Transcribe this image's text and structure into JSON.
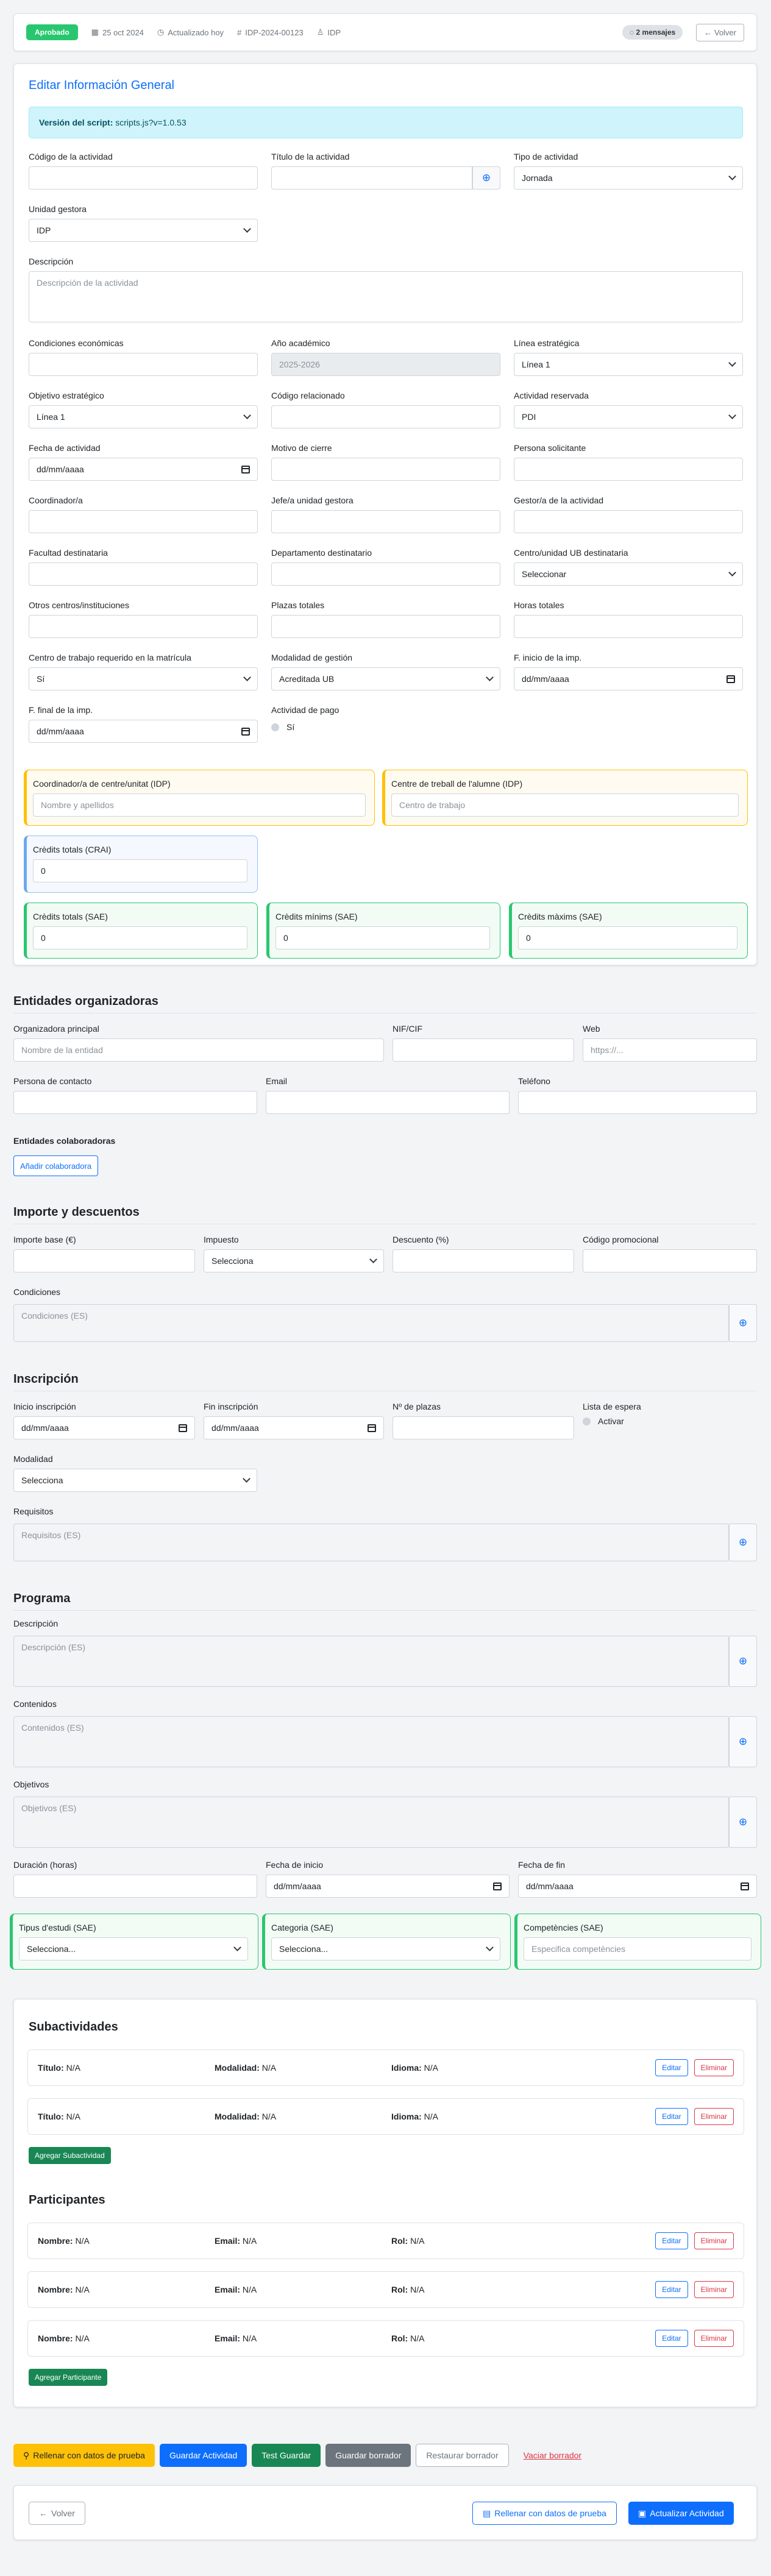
{
  "header": {
    "status": "Aprobado",
    "date": "25 oct 2024",
    "updated": "Actualizado hoy",
    "code": "IDP-2024-00123",
    "unit": "IDP",
    "messages": "2 mensajes",
    "back": "Volver"
  },
  "general": {
    "title": "Editar Información General",
    "script_label": "Versión del script:",
    "script_value": "scripts.js?v=1.0.53",
    "fields": {
      "codigo_label": "Código de la actividad",
      "titulo_label": "Título de la actividad",
      "tipo_label": "Tipo de actividad",
      "tipo_value": "Jornada",
      "unidad_label": "Unidad gestora",
      "unidad_value": "IDP",
      "desc_label": "Descripción",
      "desc_ph": "Descripción de la actividad",
      "cond_label": "Condiciones económicas",
      "anio_label": "Año académico",
      "anio_value": "2025-2026",
      "linea_label": "Línea estratégica",
      "linea_value": "Línea 1",
      "obj_label": "Objetivo estratégico",
      "obj_value": "Línea 1",
      "codrel_label": "Código relacionado",
      "reserv_label": "Actividad reservada",
      "reserv_value": "PDI",
      "fecha_label": "Fecha de actividad",
      "date_ph": "dd/mm/aaaa",
      "motivo_label": "Motivo de cierre",
      "persona_label": "Persona solicitante",
      "coord_label": "Coordinador/a",
      "jefe_label": "Jefe/a unidad gestora",
      "gestor_label": "Gestor/a de la actividad",
      "facultad_label": "Facultad destinataria",
      "depto_label": "Departamento destinatario",
      "centro_label": "Centro/unidad UB destinataria",
      "centro_value": "Seleccionar",
      "otros_label": "Otros centros/instituciones",
      "plazas_label": "Plazas totales",
      "horas_label": "Horas totales",
      "ctrab_label": "Centro de trabajo requerido en la matrícula",
      "ctrab_value": "Sí",
      "modal_label": "Modalidad de gestión",
      "modal_value": "Acreditada UB",
      "finicio_label": "F. inicio de la imp.",
      "ffinal_label": "F. final de la imp.",
      "pago_label": "Actividad de pago",
      "pago_option": "Sí"
    },
    "idp": {
      "coord_label": "Coordinador/a de centre/unitat (IDP)",
      "coord_ph": "Nombre y apellidos",
      "centre_label": "Centre de treball de l'alumne (IDP)",
      "centre_ph": "Centro de trabajo"
    },
    "crai": {
      "label": "Crèdits totals (CRAI)",
      "value": "0"
    },
    "sae": {
      "tot_label": "Crèdits totals (SAE)",
      "tot_value": "0",
      "min_label": "Crèdits mínims (SAE)",
      "min_value": "0",
      "max_label": "Crèdits màxims (SAE)",
      "max_value": "0"
    }
  },
  "entidades": {
    "title": "Entidades organizadoras",
    "org_label": "Organizadora principal",
    "org_ph": "Nombre de la entidad",
    "nif_label": "NIF/CIF",
    "web_label": "Web",
    "web_ph": "https://...",
    "contact_label": "Persona de contacto",
    "email_label": "Email",
    "tel_label": "Teléfono",
    "colab_label": "Entidades colaboradoras",
    "colab_btn": "Añadir colaboradora"
  },
  "importe": {
    "title": "Importe y descuentos",
    "base_label": "Importe base (€)",
    "imp_label": "Impuesto",
    "imp_value": "Selecciona",
    "desc_label": "Descuento (%)",
    "promo_label": "Código promocional",
    "cond_label": "Condiciones",
    "cond_ph": "Condiciones (ES)"
  },
  "inscripcion": {
    "title": "Inscripción",
    "inicio_label": "Inicio inscripción",
    "fin_label": "Fin inscripción",
    "plazas_label": "Nº de plazas",
    "espera_label": "Lista de espera",
    "espera_option": "Activar",
    "modalidad_label": "Modalidad",
    "modalidad_value": "Selecciona",
    "req_label": "Requisitos",
    "req_ph": "Requisitos (ES)"
  },
  "programa": {
    "title": "Programa",
    "desc_label": "Descripción",
    "desc_ph": "Descripción (ES)",
    "cont_label": "Contenidos",
    "cont_ph": "Contenidos (ES)",
    "obj_label": "Objetivos",
    "obj_ph": "Objetivos (ES)",
    "dur_label": "Duración (horas)",
    "fini_label": "Fecha de inicio",
    "ffin_label": "Fecha de fin",
    "tipus_label": "Tipus d'estudi (SAE)",
    "tipus_value": "Selecciona...",
    "cat_label": "Categoria (SAE)",
    "cat_value": "Selecciona...",
    "comp_label": "Competències (SAE)",
    "comp_ph": "Especifica competències"
  },
  "subactividades": {
    "title": "Subactividades",
    "rows": [
      {
        "k1": "Título:",
        "v1": "N/A",
        "k2": "Modalidad:",
        "v2": "N/A",
        "k3": "Idioma:",
        "v3": "N/A"
      },
      {
        "k1": "Título:",
        "v1": "N/A",
        "k2": "Modalidad:",
        "v2": "N/A",
        "k3": "Idioma:",
        "v3": "N/A"
      }
    ],
    "edit": "Editar",
    "delete": "Eliminar",
    "add": "Agregar Subactividad"
  },
  "participantes": {
    "title": "Participantes",
    "rows": [
      {
        "k1": "Nombre:",
        "v1": "N/A",
        "k2": "Email:",
        "v2": "N/A",
        "k3": "Rol:",
        "v3": "N/A"
      },
      {
        "k1": "Nombre:",
        "v1": "N/A",
        "k2": "Email:",
        "v2": "N/A",
        "k3": "Rol:",
        "v3": "N/A"
      },
      {
        "k1": "Nombre:",
        "v1": "N/A",
        "k2": "Email:",
        "v2": "N/A",
        "k3": "Rol:",
        "v3": "N/A"
      }
    ],
    "edit": "Editar",
    "delete": "Eliminar",
    "add": "Agregar Participante"
  },
  "actions": {
    "fill": "Rellenar con datos de prueba",
    "save": "Guardar Actividad",
    "test": "Test Guardar",
    "draft": "Guardar borrador",
    "restore": "Restaurar borrador",
    "empty": "Vaciar borrador"
  },
  "footer": {
    "back": "Volver",
    "fill": "Rellenar con datos de prueba",
    "update": "Actualizar Actividad"
  },
  "colors": {
    "primary": "#0d6efd",
    "success": "#198754",
    "warning": "#ffc107",
    "danger": "#dc3545"
  }
}
